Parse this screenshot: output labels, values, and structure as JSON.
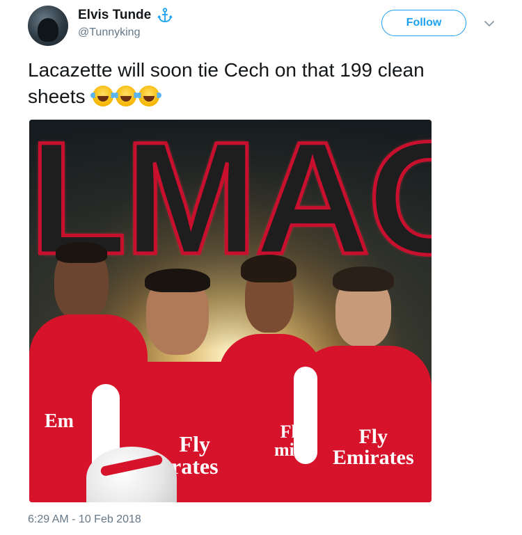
{
  "tweet": {
    "display_name": "Elvis Tunde",
    "handle": "@Tunnyking",
    "follow_label": "Follow",
    "text": "Lacazette will soon tie Cech on that 199 clean sheets",
    "emoji": [
      "face-with-tears-of-joy",
      "face-with-tears-of-joy",
      "face-with-tears-of-joy"
    ],
    "timestamp": "6:29 AM - 10 Feb 2018",
    "accent_color": "#1da1f2"
  },
  "media": {
    "overlay_text": "LMAO",
    "sponsor_text_left": "Fly\nrates",
    "sponsor_text_right": "Fly\nEmirates",
    "partial_text_back_left": "Em",
    "partial_text_back_right": "Fl\nmir",
    "kit_color": "#d6132b",
    "stroke_color": "#c8102e"
  }
}
